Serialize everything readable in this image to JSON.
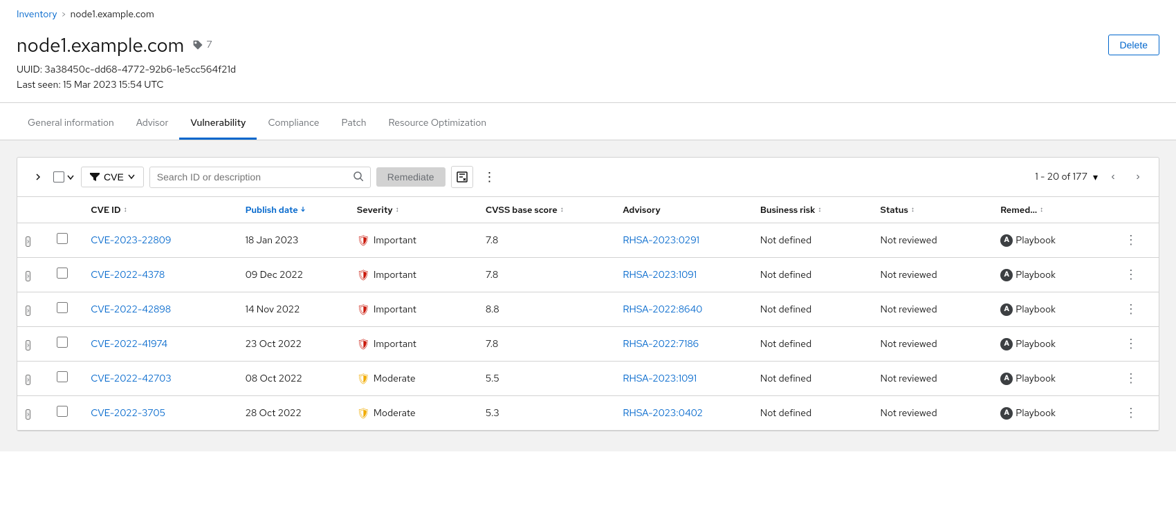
{
  "breadcrumb": {
    "link_label": "Inventory",
    "separator": ">",
    "current": "node1.example.com"
  },
  "header": {
    "title": "node1.example.com",
    "tag_count": "7",
    "uuid_label": "UUID: 3a38450c-dd68-4772-92b6-1e5cc564f21d",
    "last_seen": "Last seen: 15 Mar 2023 15:54 UTC",
    "delete_label": "Delete"
  },
  "tabs": [
    {
      "id": "general",
      "label": "General information",
      "active": false
    },
    {
      "id": "advisor",
      "label": "Advisor",
      "active": false
    },
    {
      "id": "vulnerability",
      "label": "Vulnerability",
      "active": true
    },
    {
      "id": "compliance",
      "label": "Compliance",
      "active": false
    },
    {
      "id": "patch",
      "label": "Patch",
      "active": false
    },
    {
      "id": "resource",
      "label": "Resource Optimization",
      "active": false
    }
  ],
  "toolbar": {
    "filter_label": "CVE",
    "search_placeholder": "Search ID or description",
    "remediate_label": "Remediate",
    "pagination": {
      "range": "1 - 20 of 177"
    }
  },
  "table": {
    "columns": [
      {
        "id": "cve_id",
        "label": "CVE ID",
        "sortable": true,
        "sorted": false
      },
      {
        "id": "publish_date",
        "label": "Publish date",
        "sortable": true,
        "sorted": true,
        "sort_dir": "desc"
      },
      {
        "id": "severity",
        "label": "Severity",
        "sortable": true,
        "sorted": false
      },
      {
        "id": "cvss_base_score",
        "label": "CVSS base score",
        "sortable": true,
        "sorted": false
      },
      {
        "id": "advisory",
        "label": "Advisory",
        "sortable": false,
        "sorted": false
      },
      {
        "id": "business_risk",
        "label": "Business risk",
        "sortable": true,
        "sorted": false
      },
      {
        "id": "status",
        "label": "Status",
        "sortable": true,
        "sorted": false
      },
      {
        "id": "remed",
        "label": "Remed...",
        "sortable": true,
        "sorted": false
      }
    ],
    "rows": [
      {
        "cve_id": "CVE-2023-22809",
        "publish_date": "18 Jan 2023",
        "severity": "Important",
        "severity_level": "important",
        "cvss_base_score": "7.8",
        "advisory": "RHSA-2023:0291",
        "business_risk": "Not defined",
        "status": "Not reviewed",
        "remed": "Playbook"
      },
      {
        "cve_id": "CVE-2022-4378",
        "publish_date": "09 Dec 2022",
        "severity": "Important",
        "severity_level": "important",
        "cvss_base_score": "7.8",
        "advisory": "RHSA-2023:1091",
        "business_risk": "Not defined",
        "status": "Not reviewed",
        "remed": "Playbook"
      },
      {
        "cve_id": "CVE-2022-42898",
        "publish_date": "14 Nov 2022",
        "severity": "Important",
        "severity_level": "important",
        "cvss_base_score": "8.8",
        "advisory": "RHSA-2022:8640",
        "business_risk": "Not defined",
        "status": "Not reviewed",
        "remed": "Playbook"
      },
      {
        "cve_id": "CVE-2022-41974",
        "publish_date": "23 Oct 2022",
        "severity": "Important",
        "severity_level": "important",
        "cvss_base_score": "7.8",
        "advisory": "RHSA-2022:7186",
        "business_risk": "Not defined",
        "status": "Not reviewed",
        "remed": "Playbook"
      },
      {
        "cve_id": "CVE-2022-42703",
        "publish_date": "08 Oct 2022",
        "severity": "Moderate",
        "severity_level": "moderate",
        "cvss_base_score": "5.5",
        "advisory": "RHSA-2023:1091",
        "business_risk": "Not defined",
        "status": "Not reviewed",
        "remed": "Playbook"
      },
      {
        "cve_id": "CVE-2022-3705",
        "publish_date": "28 Oct 2022",
        "severity": "Moderate",
        "severity_level": "moderate",
        "cvss_base_score": "5.3",
        "advisory": "RHSA-2023:0402",
        "business_risk": "Not defined",
        "status": "Not reviewed",
        "remed": "Playbook"
      }
    ]
  }
}
